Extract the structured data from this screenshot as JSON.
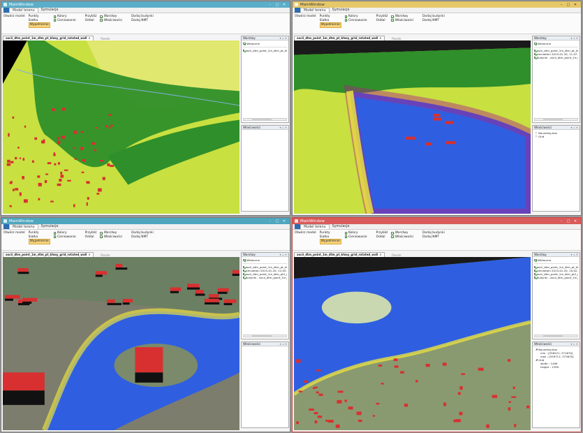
{
  "window_title": "MainWindow",
  "tabs": {
    "file": "",
    "model": "Model terenu",
    "sim": "Symulacje"
  },
  "ribbon": {
    "open_model": "Otwórz model",
    "punkty": "Punkty",
    "siatka": "Siatka",
    "wypelnienie": "Wypełnienie",
    "kolory": "Kolory",
    "cieniowanie": "Cieniowanie",
    "przybliz": "Przybliż",
    "oddal": "Oddal",
    "warstwy": "Warstwy",
    "wlasciwosci": "Właściwości",
    "dodaj_budynki": "Dodaj budynki",
    "dodaj_nmt": "Dodaj NMT",
    "group_model": "Model",
    "group_panele": "Panele"
  },
  "windows": [
    {
      "doc_tab": "ascii_dtm_point_1m_dtm_pt_kłasy_grid_rotated_wall",
      "layers_title": "Warstwy",
      "all_visible": "Widoczne",
      "layers": [
        "ascii_dtm_point_1m_dtm_pt_kła"
      ],
      "props_title": "Właściwości",
      "props": []
    },
    {
      "doc_tab": "ascii_dtm_point_1m_dtm_pt_kłasy_grid_rotated_wall",
      "layers_title": "Warstwy",
      "all_visible": "Widoczne",
      "layers": [
        "ascii_dtm_point_1m_dtm_pt_kłasy_",
        "simulation 2015-01-20, 11-07-20",
        "Budynki - ascii_dtm_point_1m_dtm"
      ],
      "props_title": "Właściwości",
      "props": [
        "Bounding box",
        "Grid"
      ]
    },
    {
      "doc_tab": "ascii_dtm_point_1m_dtm_pt_kłasy_grid_rotated_wall",
      "layers_title": "Warstwy",
      "all_visible": "Widoczne",
      "layers": [
        "ascii_dtm_point_1m_dtm_pt_kłasy",
        "simulation 2015-01-20, 12-03-14",
        "ascii_dtm_point_1m_dtm_pt2_grid",
        "Budynki - ascii_dtm_point_1m_dtm"
      ],
      "props_title": "Właściwości",
      "props": []
    },
    {
      "doc_tab": "ascii_dtm_point_1m_dtm_pt_kłasy_grid_rotated_wall",
      "layers_title": "Warstwy",
      "all_visible": "Widoczne",
      "layers": [
        "ascii_dtm_point_1m_dtm_pt_kłasy_grid_rotated",
        "simulation 2015-01-20, 10-02-16, 0",
        "ascii_dtm_point_1m_dtm_pt2_grid",
        "Budynki - ascii_dtm_point_1m_dtm_pt2_grid"
      ],
      "props_title": "Właściwości",
      "props": [
        "Bounding box",
        "min : [556221; 371670]",
        "max : [559711; 373670]",
        "Grid",
        "width : 1499",
        "height : 1399"
      ]
    }
  ],
  "colors": {
    "water": "#2f5fe0",
    "flood_edge": "#e8e040",
    "forest": "#2f8f2a",
    "field": "#c8e040",
    "building": "#d83030"
  }
}
